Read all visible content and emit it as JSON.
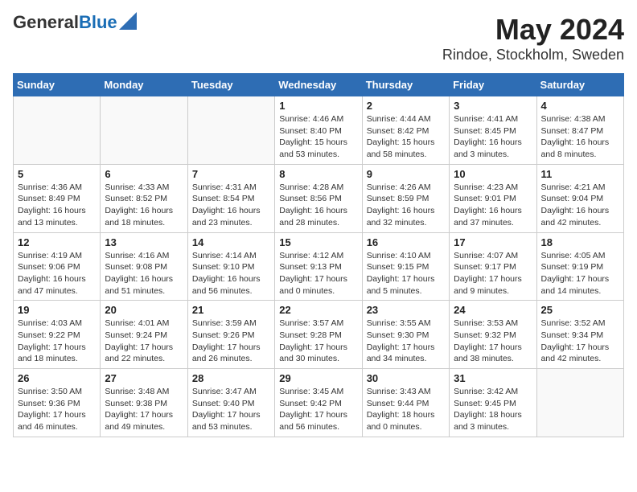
{
  "header": {
    "logo_line1": "General",
    "logo_line2": "Blue",
    "title": "May 2024",
    "subtitle": "Rindoe, Stockholm, Sweden"
  },
  "days_of_week": [
    "Sunday",
    "Monday",
    "Tuesday",
    "Wednesday",
    "Thursday",
    "Friday",
    "Saturday"
  ],
  "weeks": [
    [
      {
        "day": "",
        "info": ""
      },
      {
        "day": "",
        "info": ""
      },
      {
        "day": "",
        "info": ""
      },
      {
        "day": "1",
        "info": "Sunrise: 4:46 AM\nSunset: 8:40 PM\nDaylight: 15 hours\nand 53 minutes."
      },
      {
        "day": "2",
        "info": "Sunrise: 4:44 AM\nSunset: 8:42 PM\nDaylight: 15 hours\nand 58 minutes."
      },
      {
        "day": "3",
        "info": "Sunrise: 4:41 AM\nSunset: 8:45 PM\nDaylight: 16 hours\nand 3 minutes."
      },
      {
        "day": "4",
        "info": "Sunrise: 4:38 AM\nSunset: 8:47 PM\nDaylight: 16 hours\nand 8 minutes."
      }
    ],
    [
      {
        "day": "5",
        "info": "Sunrise: 4:36 AM\nSunset: 8:49 PM\nDaylight: 16 hours\nand 13 minutes."
      },
      {
        "day": "6",
        "info": "Sunrise: 4:33 AM\nSunset: 8:52 PM\nDaylight: 16 hours\nand 18 minutes."
      },
      {
        "day": "7",
        "info": "Sunrise: 4:31 AM\nSunset: 8:54 PM\nDaylight: 16 hours\nand 23 minutes."
      },
      {
        "day": "8",
        "info": "Sunrise: 4:28 AM\nSunset: 8:56 PM\nDaylight: 16 hours\nand 28 minutes."
      },
      {
        "day": "9",
        "info": "Sunrise: 4:26 AM\nSunset: 8:59 PM\nDaylight: 16 hours\nand 32 minutes."
      },
      {
        "day": "10",
        "info": "Sunrise: 4:23 AM\nSunset: 9:01 PM\nDaylight: 16 hours\nand 37 minutes."
      },
      {
        "day": "11",
        "info": "Sunrise: 4:21 AM\nSunset: 9:04 PM\nDaylight: 16 hours\nand 42 minutes."
      }
    ],
    [
      {
        "day": "12",
        "info": "Sunrise: 4:19 AM\nSunset: 9:06 PM\nDaylight: 16 hours\nand 47 minutes."
      },
      {
        "day": "13",
        "info": "Sunrise: 4:16 AM\nSunset: 9:08 PM\nDaylight: 16 hours\nand 51 minutes."
      },
      {
        "day": "14",
        "info": "Sunrise: 4:14 AM\nSunset: 9:10 PM\nDaylight: 16 hours\nand 56 minutes."
      },
      {
        "day": "15",
        "info": "Sunrise: 4:12 AM\nSunset: 9:13 PM\nDaylight: 17 hours\nand 0 minutes."
      },
      {
        "day": "16",
        "info": "Sunrise: 4:10 AM\nSunset: 9:15 PM\nDaylight: 17 hours\nand 5 minutes."
      },
      {
        "day": "17",
        "info": "Sunrise: 4:07 AM\nSunset: 9:17 PM\nDaylight: 17 hours\nand 9 minutes."
      },
      {
        "day": "18",
        "info": "Sunrise: 4:05 AM\nSunset: 9:19 PM\nDaylight: 17 hours\nand 14 minutes."
      }
    ],
    [
      {
        "day": "19",
        "info": "Sunrise: 4:03 AM\nSunset: 9:22 PM\nDaylight: 17 hours\nand 18 minutes."
      },
      {
        "day": "20",
        "info": "Sunrise: 4:01 AM\nSunset: 9:24 PM\nDaylight: 17 hours\nand 22 minutes."
      },
      {
        "day": "21",
        "info": "Sunrise: 3:59 AM\nSunset: 9:26 PM\nDaylight: 17 hours\nand 26 minutes."
      },
      {
        "day": "22",
        "info": "Sunrise: 3:57 AM\nSunset: 9:28 PM\nDaylight: 17 hours\nand 30 minutes."
      },
      {
        "day": "23",
        "info": "Sunrise: 3:55 AM\nSunset: 9:30 PM\nDaylight: 17 hours\nand 34 minutes."
      },
      {
        "day": "24",
        "info": "Sunrise: 3:53 AM\nSunset: 9:32 PM\nDaylight: 17 hours\nand 38 minutes."
      },
      {
        "day": "25",
        "info": "Sunrise: 3:52 AM\nSunset: 9:34 PM\nDaylight: 17 hours\nand 42 minutes."
      }
    ],
    [
      {
        "day": "26",
        "info": "Sunrise: 3:50 AM\nSunset: 9:36 PM\nDaylight: 17 hours\nand 46 minutes."
      },
      {
        "day": "27",
        "info": "Sunrise: 3:48 AM\nSunset: 9:38 PM\nDaylight: 17 hours\nand 49 minutes."
      },
      {
        "day": "28",
        "info": "Sunrise: 3:47 AM\nSunset: 9:40 PM\nDaylight: 17 hours\nand 53 minutes."
      },
      {
        "day": "29",
        "info": "Sunrise: 3:45 AM\nSunset: 9:42 PM\nDaylight: 17 hours\nand 56 minutes."
      },
      {
        "day": "30",
        "info": "Sunrise: 3:43 AM\nSunset: 9:44 PM\nDaylight: 18 hours\nand 0 minutes."
      },
      {
        "day": "31",
        "info": "Sunrise: 3:42 AM\nSunset: 9:45 PM\nDaylight: 18 hours\nand 3 minutes."
      },
      {
        "day": "",
        "info": ""
      }
    ]
  ]
}
